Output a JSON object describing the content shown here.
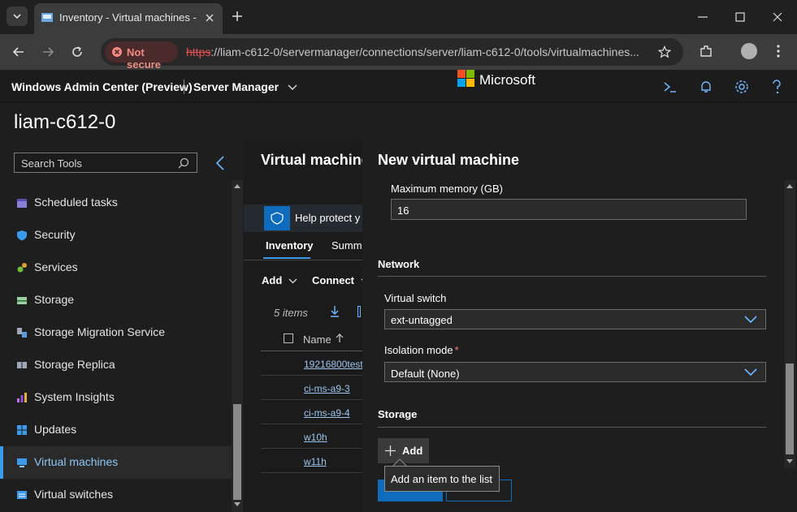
{
  "browser": {
    "tab_title": "Inventory - Virtual machines - S",
    "not_secure": "Not secure",
    "url_scheme": "https",
    "url_rest": "://liam-c612-0/servermanager/connections/server/liam-c612-0/tools/virtualmachines..."
  },
  "wac": {
    "app_name": "Windows Admin Center (Preview)",
    "context": "Server Manager",
    "brand": "Microsoft",
    "server_name": "liam-c612-0"
  },
  "sidebar": {
    "search_placeholder": "Search Tools",
    "items": [
      {
        "label": "Scheduled tasks",
        "icon": "calendar-icon"
      },
      {
        "label": "Security",
        "icon": "shield-icon"
      },
      {
        "label": "Services",
        "icon": "gears-icon"
      },
      {
        "label": "Storage",
        "icon": "storage-icon"
      },
      {
        "label": "Storage Migration Service",
        "icon": "migration-icon"
      },
      {
        "label": "Storage Replica",
        "icon": "replica-icon"
      },
      {
        "label": "System Insights",
        "icon": "insights-icon"
      },
      {
        "label": "Updates",
        "icon": "updates-icon"
      },
      {
        "label": "Virtual machines",
        "icon": "vm-icon"
      },
      {
        "label": "Virtual switches",
        "icon": "switch-icon"
      }
    ],
    "active_index": 8
  },
  "content": {
    "title": "Virtual machine",
    "banner": "Help protect y",
    "tabs": [
      "Inventory",
      "Summ"
    ],
    "toolbar": {
      "add": "Add",
      "connect": "Connect"
    },
    "count": "5 items",
    "column_name": "Name",
    "rows": [
      "19216800test",
      "ci-ms-a9-3",
      "ci-ms-a9-4",
      "w10h",
      "w11h"
    ]
  },
  "panel": {
    "title": "New virtual machine",
    "max_memory_label": "Maximum memory (GB)",
    "max_memory_value": "16",
    "network_heading": "Network",
    "vswitch_label": "Virtual switch",
    "vswitch_value": "ext-untagged",
    "isolation_label": "Isolation mode",
    "isolation_required": "*",
    "isolation_value": "Default (None)",
    "storage_heading": "Storage",
    "add_label": "Add",
    "tooltip": "Add an item to the list"
  },
  "colors": {
    "accent": "#0f6cbd",
    "required": "#f87c86"
  }
}
